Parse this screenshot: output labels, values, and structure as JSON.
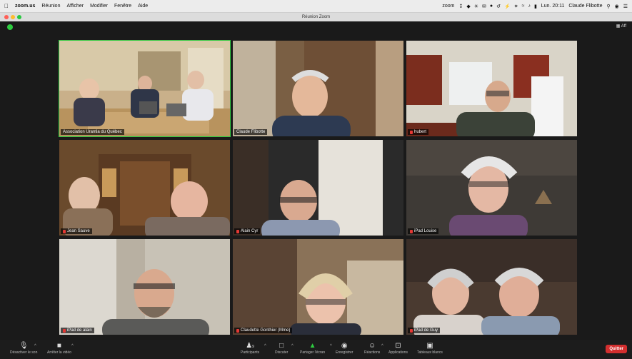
{
  "menubar": {
    "app": "zoom.us",
    "items": [
      "Réunion",
      "Afficher",
      "Modifier",
      "Fenêtre",
      "Aide"
    ],
    "status_app": "zoom",
    "clock": "Lun. 20:11",
    "user": "Claude Flibotte"
  },
  "window": {
    "title": "Réunion Zoom",
    "view_label": "Aff"
  },
  "participants": [
    {
      "name": "Association Urantia du Québec",
      "muted": false,
      "active": true
    },
    {
      "name": "Claude Flibotte",
      "muted": false,
      "active": false
    },
    {
      "name": "hubert",
      "muted": true,
      "active": false
    },
    {
      "name": "Jean Sauve",
      "muted": true,
      "active": false
    },
    {
      "name": "Alain Cyr",
      "muted": true,
      "active": false
    },
    {
      "name": "iPad Louise",
      "muted": true,
      "active": false
    },
    {
      "name": "iPad de alain",
      "muted": true,
      "active": false
    },
    {
      "name": "Claudette Gonthier (Mme)",
      "muted": true,
      "active": false
    },
    {
      "name": "iPad de Guy",
      "muted": true,
      "active": false
    }
  ],
  "toolbar": {
    "mute": "Désactiver le son",
    "video": "Arrêter la vidéo",
    "participants": "Participants",
    "participants_count": "9",
    "chat": "Discuter",
    "share": "Partager l'écran",
    "record": "Enregistrer",
    "reactions": "Réactions",
    "apps": "Applications",
    "whiteboard": "Tableaux blancs",
    "quit": "Quitter"
  },
  "colors": {
    "active_speaker": "#2ecc40",
    "quit_button": "#d32f2f",
    "mute_indicator": "#e53935"
  }
}
